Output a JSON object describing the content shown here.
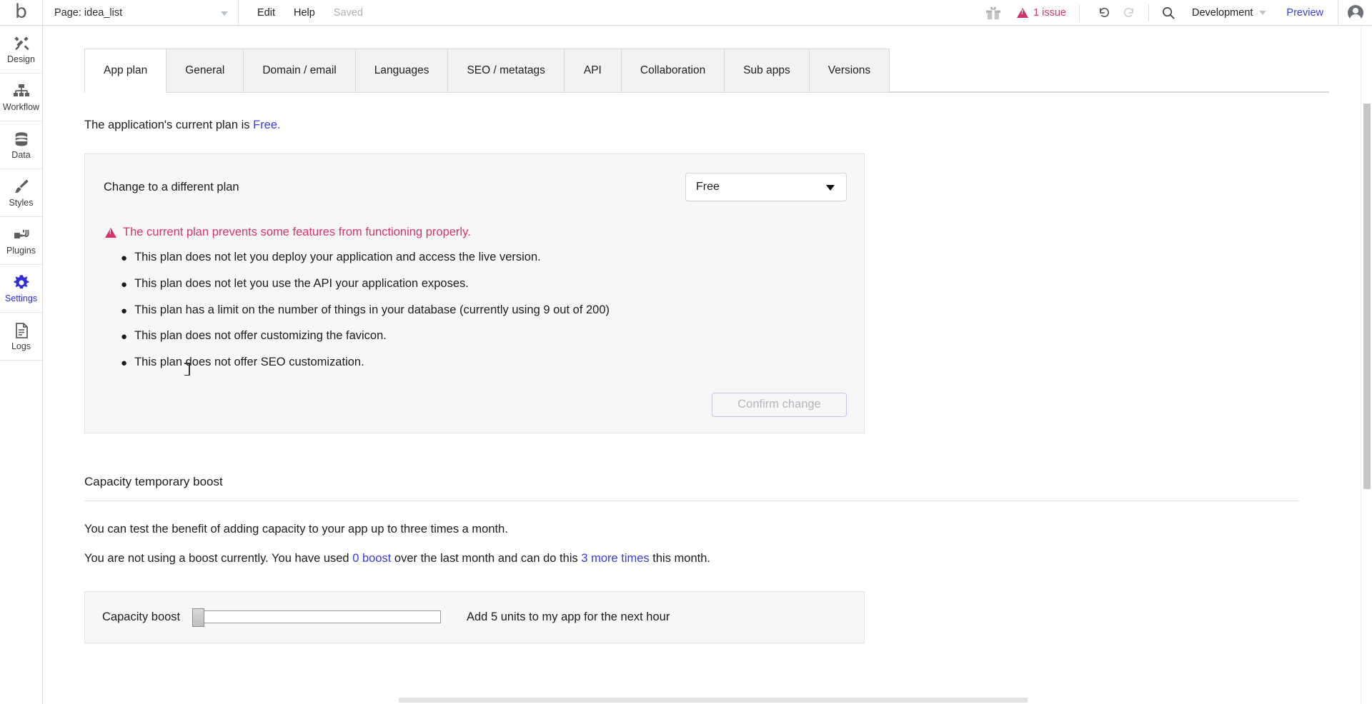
{
  "header": {
    "logo": "b",
    "page_selector": "Page: idea_list",
    "edit": "Edit",
    "help": "Help",
    "saved": "Saved",
    "gift_icon": "gift-icon",
    "issue_count": "1 issue",
    "undo_icon": "undo-icon",
    "redo_icon": "redo-icon",
    "search_icon": "search-icon",
    "environment": "Development",
    "preview": "Preview",
    "avatar_icon": "user-avatar-icon",
    "issue_color": "#d6336c",
    "link_color": "#3b3bd6"
  },
  "sidebar": {
    "items": [
      {
        "label": "Design",
        "icon": "design-icon",
        "active": false
      },
      {
        "label": "Workflow",
        "icon": "workflow-icon",
        "active": false
      },
      {
        "label": "Data",
        "icon": "database-icon",
        "active": false
      },
      {
        "label": "Styles",
        "icon": "brush-icon",
        "active": false
      },
      {
        "label": "Plugins",
        "icon": "plug-icon",
        "active": false
      },
      {
        "label": "Settings",
        "icon": "gear-icon",
        "active": true
      },
      {
        "label": "Logs",
        "icon": "document-icon",
        "active": false
      }
    ],
    "active_color": "#2d2de0"
  },
  "tabs": [
    {
      "label": "App plan",
      "active": true
    },
    {
      "label": "General",
      "active": false
    },
    {
      "label": "Domain / email",
      "active": false
    },
    {
      "label": "Languages",
      "active": false
    },
    {
      "label": "SEO / metatags",
      "active": false
    },
    {
      "label": "API",
      "active": false
    },
    {
      "label": "Collaboration",
      "active": false
    },
    {
      "label": "Sub apps",
      "active": false
    },
    {
      "label": "Versions",
      "active": false
    }
  ],
  "app_plan": {
    "intro_prefix": "The application's current plan is ",
    "intro_plan": "Free.",
    "change_label": "Change to a different plan",
    "plan_select_value": "Free",
    "plan_select_options": [
      "Free"
    ],
    "warning_icon": "warning-triangle-icon",
    "warning_text": "The current plan prevents some features from functioning properly.",
    "limitations": [
      "This plan does not let you deploy your application and access the live version.",
      "This plan does not let you use the API your application exposes.",
      "This plan has a limit on the number of things in your database (currently using 9 out of 200)",
      "This plan does not offer customizing the favicon.",
      "This plan does not offer SEO customization."
    ],
    "confirm_button": "Confirm change",
    "confirm_disabled": true
  },
  "capacity": {
    "section_title": "Capacity temporary boost",
    "paragraph_1": "You can test the benefit of adding capacity to your app up to three times a month.",
    "paragraph_2_part1": "You are not using a boost currently. You have used ",
    "paragraph_2_link1": "0 boost",
    "paragraph_2_part2": " over the last month and can do this ",
    "paragraph_2_link2": "3 more times",
    "paragraph_2_part3": " this month.",
    "slider_label": "Capacity boost",
    "slider_value": 0,
    "slider_min": 0,
    "slider_max": 100,
    "slider_caption": "Add 5 units to my app for the next hour"
  }
}
